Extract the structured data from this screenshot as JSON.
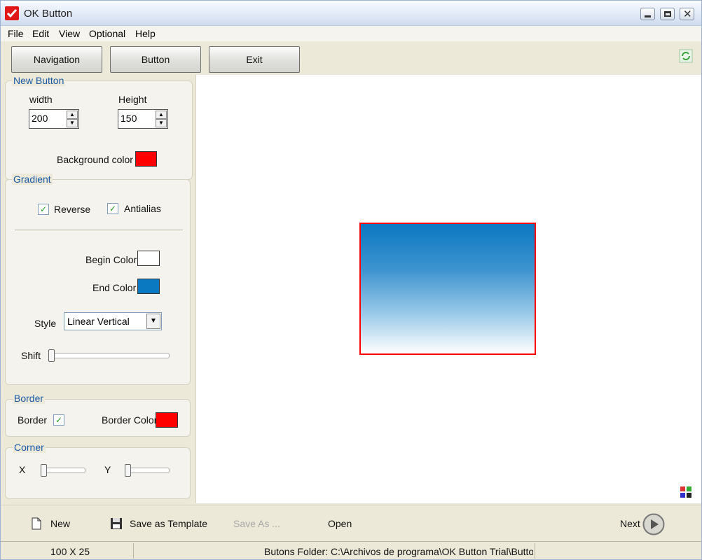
{
  "window": {
    "title": "OK Button"
  },
  "menu": [
    "File",
    "Edit",
    "View",
    "Optional",
    "Help"
  ],
  "toolbar": {
    "navigation": "Navigation",
    "button": "Button",
    "exit": "Exit"
  },
  "new_button": {
    "title": "New Button",
    "width_label": "width",
    "width_value": "200",
    "height_label": "Height",
    "height_value": "150",
    "bg_label": "Background color",
    "bg_color": "#ff0000"
  },
  "gradient": {
    "title": "Gradient",
    "reverse_label": "Reverse",
    "reverse_checked": true,
    "antialias_label": "Antialias",
    "antialias_checked": true,
    "begin_label": "Begin Color",
    "begin_color": "#ffffff",
    "end_label": "End Color",
    "end_color": "#0b78c2",
    "style_label": "Style",
    "style_value": "Linear Vertical",
    "shift_label": "Shift"
  },
  "border": {
    "title": "Border",
    "border_label": "Border",
    "border_checked": true,
    "color_label": "Border Color",
    "color": "#ff0000"
  },
  "corner": {
    "title": "Corner",
    "x_label": "X",
    "y_label": "Y"
  },
  "bottom": {
    "new": "New",
    "save_template": "Save as Template",
    "save_as": "Save As ...",
    "open": "Open",
    "next": "Next"
  },
  "status": {
    "size": "100 X 25",
    "folder": "Butons Folder: C:\\Archivos de programa\\OK Button Trial\\Buttor"
  }
}
